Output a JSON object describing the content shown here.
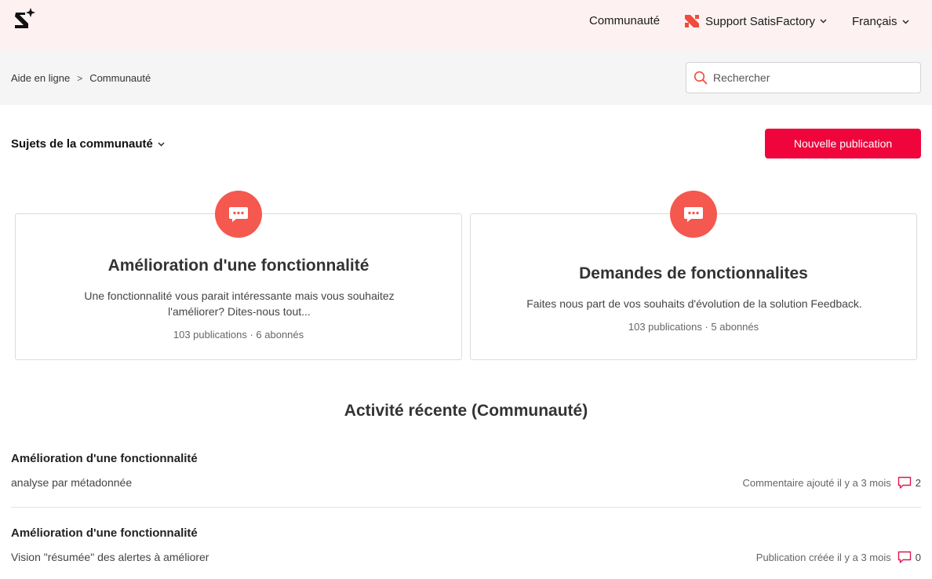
{
  "header": {
    "nav_community": "Communauté",
    "nav_support": "Support SatisFactory",
    "nav_language": "Français"
  },
  "breadcrumb": {
    "items": [
      "Aide en ligne",
      "Communauté"
    ],
    "separator": ">"
  },
  "search": {
    "placeholder": "Rechercher"
  },
  "topics": {
    "toggle_label": "Sujets de la communauté",
    "new_post_label": "Nouvelle publication"
  },
  "cards": [
    {
      "title": "Amélioration d'une fonctionnalité",
      "description": "Une fonctionnalité vous parait intéressante mais vous souhaitez l'améliorer? Dites-nous tout...",
      "posts": "103 publications",
      "followers": "6 abonnés"
    },
    {
      "title": "Demandes de fonctionnalites",
      "description": "Faites nous part de vos souhaits d'évolution de la solution Feedback.",
      "posts": "103 publications",
      "followers": "5 abonnés"
    }
  ],
  "activity": {
    "title": "Activité récente (Communauté)",
    "items": [
      {
        "topic": "Amélioration d'une fonctionnalité",
        "post": "analyse par métadonnée",
        "status": "Commentaire ajouté il y a 3 mois",
        "comments": "2"
      },
      {
        "topic": "Amélioration d'une fonctionnalité",
        "post": "Vision \"résumée\" des alertes à améliorer",
        "status": "Publication créée il y a 3 mois",
        "comments": "0"
      }
    ]
  },
  "colors": {
    "brand_red": "#f0043c",
    "badge_coral": "#f5584e",
    "header_bg": "#fdf1f2",
    "subbar_bg": "#f5f5f5"
  },
  "icons": {
    "logo": "satisfactory-logo-icon",
    "support": "satisfactory-brand-icon",
    "search": "search-icon",
    "card_badge": "speech-bubble-icon",
    "comment": "comment-icon",
    "chevron": "chevron-down-icon"
  }
}
